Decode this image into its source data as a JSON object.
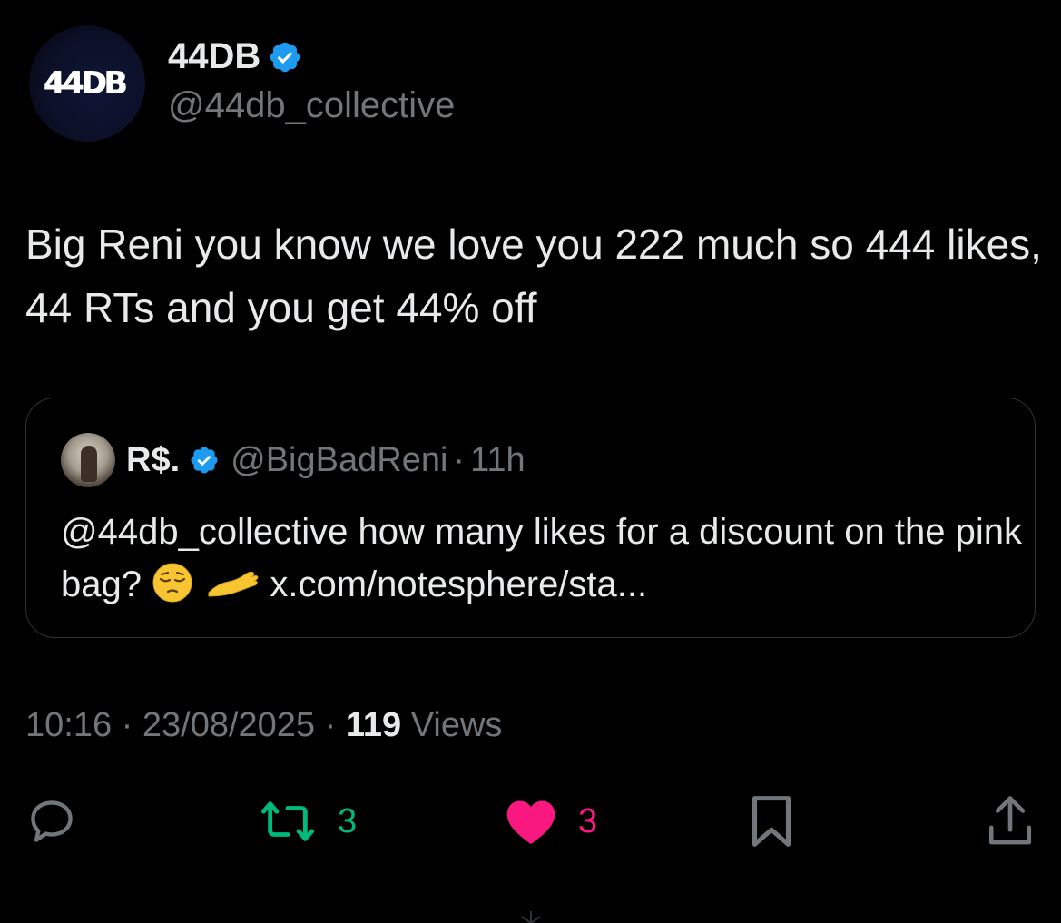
{
  "author": {
    "avatar_text": "44DB",
    "display_name": "44DB",
    "handle": "@44db_collective",
    "verified": true
  },
  "tweet": {
    "text": "Big Reni you know we love you 222 much so 444 likes, 44 RTs and you get 44% off"
  },
  "quoted_tweet": {
    "display_name": "R$.",
    "handle": "@BigBadReni",
    "separator": "·",
    "time": "11h",
    "text_before_emoji": "@44db_collective how many likes for a discount on the pink bag?",
    "emojis": [
      "pensive-face",
      "palm-up-hand"
    ],
    "link": "x.com/notesphere/sta..."
  },
  "meta": {
    "time": "10:16",
    "separator": "·",
    "date": "23/08/2025",
    "views_count": "119",
    "views_label": "Views"
  },
  "actions": {
    "reply_count": "",
    "retweet_count": "3",
    "like_count": "3"
  },
  "colors": {
    "background": "#000000",
    "primary_text": "#e7e9ea",
    "secondary_text": "#71767b",
    "verified_blue": "#1d9bf0",
    "retweet_green": "#00ba7c",
    "like_pink": "#f91880",
    "border": "#2f3336"
  }
}
